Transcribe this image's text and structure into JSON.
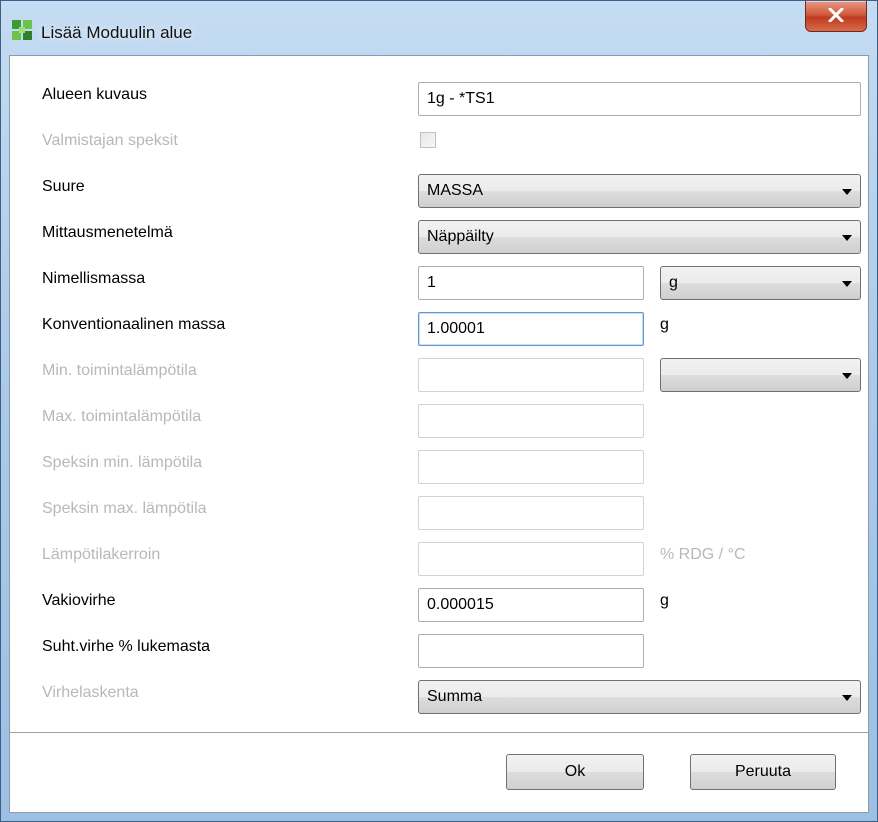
{
  "window": {
    "title": "Lisää Moduulin alue",
    "close_icon": "close-x-icon",
    "app_icon": "green-puzzle-icon"
  },
  "form": {
    "description": {
      "label": "Alueen kuvaus",
      "value": "1g - *TS1"
    },
    "manufacturer_specs": {
      "label": "Valmistajan speksit",
      "checked": false
    },
    "quantity": {
      "label": "Suure",
      "selected": "MASSA"
    },
    "method": {
      "label": "Mittausmenetelmä",
      "selected": "Näppäilty"
    },
    "nominal_mass": {
      "label": "Nimellismassa",
      "value": "1",
      "unit_selected": "g"
    },
    "conventional_mass": {
      "label": "Konventionaalinen massa",
      "value": "1.00001",
      "unit": "g"
    },
    "min_operating_temp": {
      "label": "Min. toimintalämpötila",
      "value": "",
      "unit_selected": ""
    },
    "max_operating_temp": {
      "label": "Max. toimintalämpötila",
      "value": ""
    },
    "spec_min_temp": {
      "label": "Speksin min. lämpötila",
      "value": ""
    },
    "spec_max_temp": {
      "label": "Speksin max. lämpötila",
      "value": ""
    },
    "temp_coefficient": {
      "label": "Lämpötilakerroin",
      "value": "",
      "unit": "% RDG / °C"
    },
    "constant_error": {
      "label": "Vakiovirhe",
      "value": "0.000015",
      "unit": "g"
    },
    "relative_error": {
      "label": "Suht.virhe % lukemasta",
      "value": ""
    },
    "error_calculation": {
      "label": "Virhelaskenta",
      "selected": "Summa"
    }
  },
  "buttons": {
    "ok": "Ok",
    "cancel": "Peruuta"
  },
  "colors": {
    "disabled_text": "#b8b8b8",
    "focus_border": "#5e98d4",
    "close_red": "#c03b1f"
  }
}
